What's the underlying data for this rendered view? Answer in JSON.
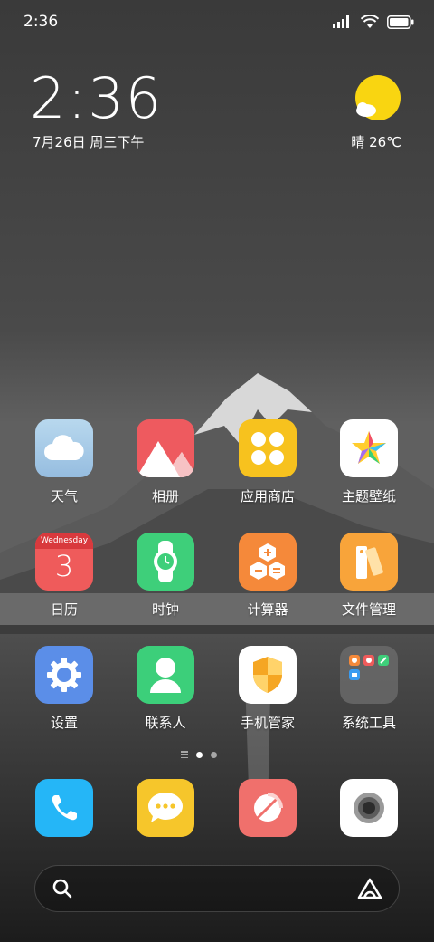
{
  "status_bar": {
    "time": "2:36"
  },
  "clock_widget": {
    "time": "2:36",
    "date": "7月26日 周三下午"
  },
  "weather_widget": {
    "text": "晴 26℃",
    "icon": "sun-cloud-icon"
  },
  "apps": [
    {
      "label": "天气",
      "icon": "weather-icon"
    },
    {
      "label": "相册",
      "icon": "gallery-icon"
    },
    {
      "label": "应用商店",
      "icon": "app-store-icon"
    },
    {
      "label": "主题壁纸",
      "icon": "themes-icon"
    },
    {
      "label": "日历",
      "icon": "calendar-icon",
      "calendar_weekday": "Wednesday",
      "calendar_day": "3"
    },
    {
      "label": "时钟",
      "icon": "clock-icon"
    },
    {
      "label": "计算器",
      "icon": "calculator-icon"
    },
    {
      "label": "文件管理",
      "icon": "file-manager-icon"
    },
    {
      "label": "设置",
      "icon": "settings-icon"
    },
    {
      "label": "联系人",
      "icon": "contacts-icon"
    },
    {
      "label": "手机管家",
      "icon": "security-icon"
    },
    {
      "label": "系统工具",
      "icon": "system-tools-folder-icon"
    }
  ],
  "page_indicator": {
    "pages": 2,
    "active": 1
  },
  "dock": [
    {
      "icon": "phone-icon"
    },
    {
      "icon": "messages-icon"
    },
    {
      "icon": "browser-icon"
    },
    {
      "icon": "camera-icon"
    }
  ],
  "colors": {
    "weather_tile": "#a9cde8",
    "gallery_tile": "#ee5a5f",
    "appstore_tile": "#f7c21e",
    "calendar_tile": "#ef5b5b",
    "clock_tile": "#3ecf7a",
    "calculator_tile": "#f5893a",
    "files_tile": "#f8a43a",
    "settings_tile": "#5b8ee8",
    "contacts_tile": "#3ccf7a",
    "phone_tile": "#25b6f7",
    "messages_tile": "#f6c62b",
    "browser_tile": "#f0706c"
  }
}
